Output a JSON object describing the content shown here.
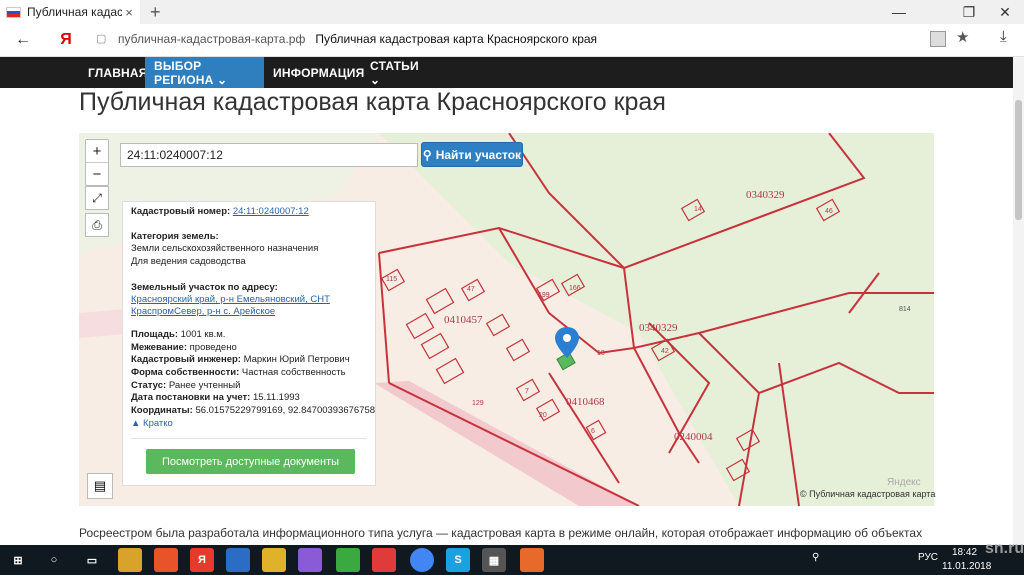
{
  "browser": {
    "tab_title": "Публичная кадастровая",
    "tab_close": "×",
    "new_tab": "+",
    "win_min": "—",
    "win_max": "❐",
    "win_close": "✕",
    "back": "←",
    "yandex_logo": "Я",
    "url_host": "публичная-кадастровая-карта.рф",
    "url_title": "Публичная кадастровая карта Красноярского края",
    "bookmark": "★",
    "download": "⤓"
  },
  "nav": {
    "items": [
      {
        "label": "ГЛАВНАЯ"
      },
      {
        "label": "ВЫБОР РЕГИОНА ⌄"
      },
      {
        "label": "ИНФОРМАЦИЯ"
      },
      {
        "label": "СТАТЬИ ⌄"
      }
    ]
  },
  "page": {
    "title": "Публичная кадастровая карта Красноярского края",
    "body_text": "Росреестром была разработала информационного типа услуга — кадастровая карта в режиме онлайн, которая отображает информацию об объектах"
  },
  "map": {
    "zoom_in": "+",
    "zoom_out": "−",
    "fullscreen": "⤢",
    "print": "⎙",
    "search_value": "24:11:0240007:12",
    "search_button": "Найти участок",
    "layers": "▤",
    "copyright": "© Публичная кадастровая карта",
    "watermark": "Яндекс",
    "labels": {
      "q1": "0340329",
      "q2": "0410457",
      "q3": "0340329",
      "q4": "0410468",
      "q5": "0240004",
      "p14": "14",
      "p46": "46",
      "p814": "814",
      "p42": "42",
      "p10": "10",
      "p20": "20",
      "p6": "6",
      "p129": "129",
      "p166": "166",
      "p199": "199",
      "p47": "47",
      "p115": "115",
      "p7": "7"
    }
  },
  "info": {
    "cad_label": "Кадастровый номер:",
    "cad_value": "24:11:0240007:12",
    "cat_label": "Категория земель:",
    "cat_value1": "Земли сельскохозяйственного назначения",
    "cat_value2": "Для ведения садоводства",
    "addr_label": "Земельный участок по адресу:",
    "addr_value1": "Красноярский край, р-н Емельяновский, СНТ",
    "addr_value2": "КраспромСевер, р-н с. Арейское",
    "area_label": "Площадь:",
    "area_value": "1001 кв.м.",
    "survey_label": "Межевание:",
    "survey_value": "проведено",
    "engineer_label": "Кадастровый инженер:",
    "engineer_value": "Маркин Юрий Петрович",
    "owner_label": "Форма собственности:",
    "owner_value": "Частная собственность",
    "status_label": "Статус:",
    "status_value": "Ранее учтенный",
    "date_label": "Дата постановки на учет:",
    "date_value": "15.11.1993",
    "coord_label": "Координаты:",
    "coord_value": "56.01575229799169, 92.84700393676758",
    "brief": "▲ Кратко",
    "docs_button": "Посмотреть доступные документы"
  },
  "taskbar": {
    "lang": "РУС",
    "time": "18:42",
    "date": "11.01.2018",
    "watermark": "sn.ru"
  },
  "colors": {
    "nav_bg": "#1d1d1d",
    "nav_active": "#2f7fbf",
    "boundary": "#c8323c",
    "button_blue": "#2f7fc5",
    "button_green": "#5cb85c"
  }
}
